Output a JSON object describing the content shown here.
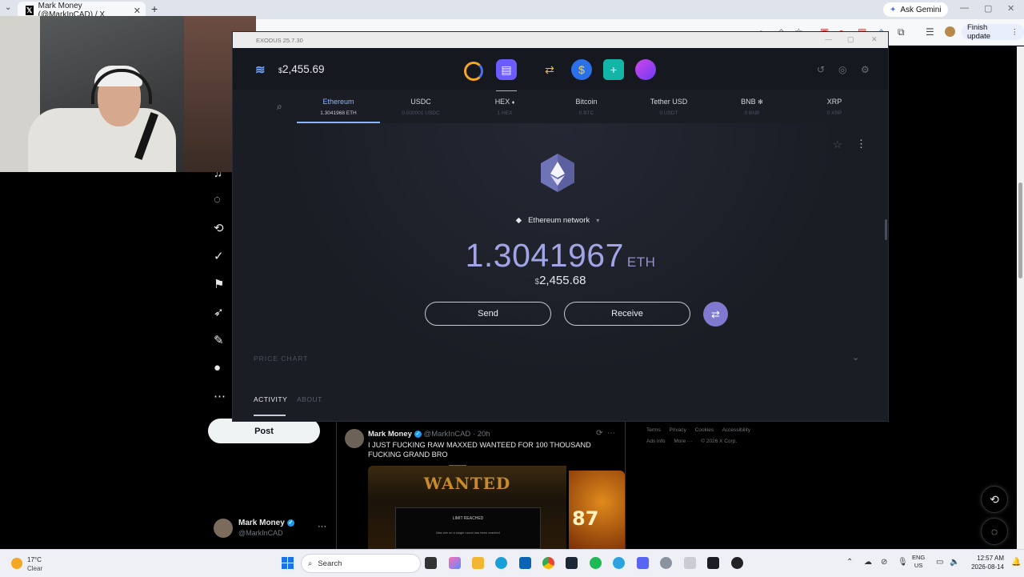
{
  "browser": {
    "tab_title": "Mark Money (@MarkInCAD) / X",
    "tab_icon": "x-logo-icon",
    "ask_gemini": "Ask Gemini",
    "finish_update": "Finish update"
  },
  "x_page": {
    "nav_icons": [
      "notifications-icon",
      "messages-icon",
      "grok-icon",
      "verified-icon",
      "bookmarks-icon",
      "rocket-icon",
      "drafts-icon",
      "profile-icon",
      "more-icon"
    ],
    "post_button": "Post",
    "profile": {
      "name": "Mark Money",
      "handle": "@MarkInCAD",
      "more": "···"
    },
    "tweet": {
      "author": "Mark Money",
      "handle": "@MarkInCAD",
      "time": "· 20h",
      "text": "I JUST FUCKING RAW MAXXED WANTEED FOR 100 THOUSAND FUCKING GRAND BRO",
      "media_title": "WANTED",
      "media_panel": "LIMIT REACHED",
      "media_panel_sub": "Max win on a single round has been reached",
      "media2_text": "87"
    },
    "footer": [
      "Terms",
      "Privacy",
      "Cookies",
      "Accessibility",
      "Ads info",
      "More ···",
      "© 2026 X Corp."
    ]
  },
  "exodus": {
    "title": "EXODUS 25.7.30",
    "balance_currency": "$",
    "balance": "2,455.69",
    "app_icons": [
      "portfolio-icon",
      "wallet-icon",
      "exchange-icon",
      "coin-s-icon",
      "plus-hex-icon",
      "nft-icon"
    ],
    "header_right_icons": [
      "history-icon",
      "profile-icon",
      "settings-icon"
    ],
    "assets": [
      {
        "name": "Ethereum",
        "balance": "1.3041968 ETH",
        "active": true
      },
      {
        "name": "USDC",
        "balance": "0.000001 USDC",
        "active": false
      },
      {
        "name": "HEX",
        "balance": "1 HEX",
        "active": false
      },
      {
        "name": "Bitcoin",
        "balance": "0 BTC",
        "active": false
      },
      {
        "name": "Tether USD",
        "balance": "0 USDT",
        "active": false
      },
      {
        "name": "BNB",
        "balance": "0 BNB",
        "active": false
      },
      {
        "name": "XRP",
        "balance": "0 XRP",
        "active": false
      }
    ],
    "network": "Ethereum network",
    "amount": "1.3041967",
    "amount_unit": "ETH",
    "fiat_currency": "$",
    "fiat_value": "2,455.68",
    "send": "Send",
    "receive": "Receive",
    "price_chart": "PRICE CHART",
    "tabs": [
      "ACTIVITY",
      "ABOUT"
    ],
    "accent_color": "#8ab4ff"
  },
  "taskbar": {
    "temperature": "17°C",
    "condition": "Clear",
    "search": "Search",
    "language": "ENG",
    "region": "US",
    "time": "12:57 AM",
    "date": "2026-08-14"
  }
}
